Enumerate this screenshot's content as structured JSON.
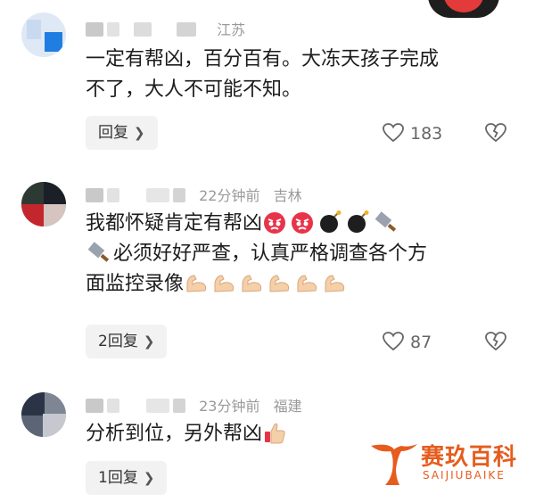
{
  "comments": [
    {
      "location": "江苏",
      "lines": [
        "一定有帮凶，百分百有。大冻天孩子完成",
        "不了，大人不可能不知。"
      ],
      "reply_label": "回复",
      "likes": "183"
    },
    {
      "time": "22分钟前",
      "location": "吉林",
      "line1": "我都怀疑肯定有帮凶",
      "line2": "必须好好严查，认真严格调查各个方",
      "line3": "面监控录像",
      "reply_label": "2回复",
      "likes": "87",
      "emojis": [
        "angry-face-emoji",
        "angry-face-emoji",
        "bomb-emoji",
        "bomb-emoji",
        "cleaver-emoji",
        "cleaver-emoji",
        "flexed-biceps-emoji x6"
      ]
    },
    {
      "time": "23分钟前",
      "location": "福建",
      "line1": "分析到位，另外帮凶",
      "reply_label": "1回复",
      "emojis": [
        "thumbs-up-emoji"
      ]
    }
  ],
  "watermark": {
    "name": "赛玖百科",
    "sub": "SAIJIUBAIKE"
  },
  "colors": {
    "meta_gray": "#9a9a9a",
    "reply_bg": "#f2f2f2",
    "watermark": "#e65c1e"
  }
}
